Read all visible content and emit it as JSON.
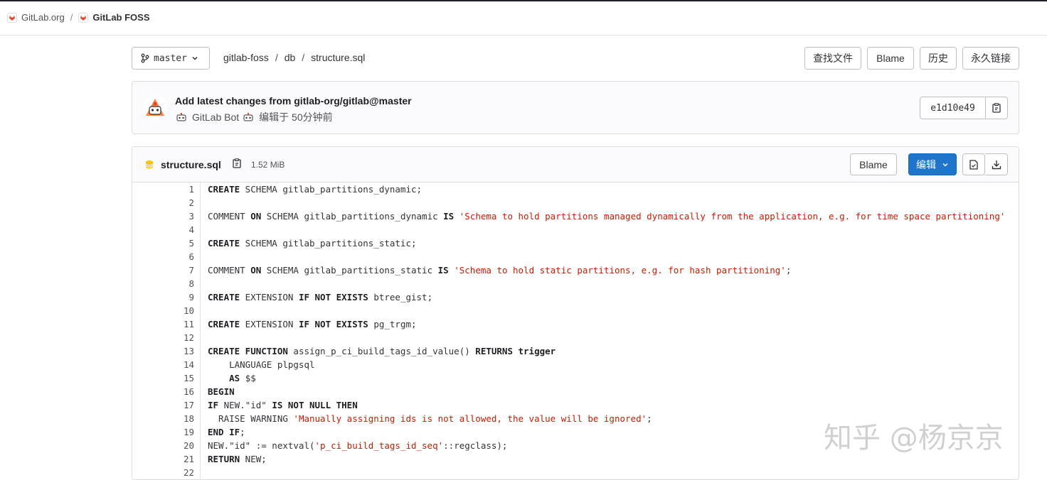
{
  "breadcrumb": {
    "group": "GitLab.org",
    "project": "GitLab FOSS"
  },
  "toolbar": {
    "branch": "master",
    "path": [
      "gitlab-foss",
      "db",
      "structure.sql"
    ],
    "find_file": "查找文件",
    "blame": "Blame",
    "history": "历史",
    "permalink": "永久链接"
  },
  "commit": {
    "title": "Add latest changes from gitlab-org/gitlab@master",
    "author": "GitLab Bot",
    "edited": "编辑于 50分钟前",
    "sha": "e1d10e49"
  },
  "file": {
    "name": "structure.sql",
    "size": "1.52 MiB",
    "blame": "Blame",
    "edit": "编辑"
  },
  "code_lines": [
    {
      "n": "1",
      "parts": [
        [
          "kw",
          "CREATE"
        ],
        [
          "plain",
          " SCHEMA gitlab_partitions_dynamic;"
        ]
      ]
    },
    {
      "n": "2",
      "parts": []
    },
    {
      "n": "3",
      "parts": [
        [
          "plain",
          "COMMENT "
        ],
        [
          "kw",
          "ON"
        ],
        [
          "plain",
          " SCHEMA gitlab_partitions_dynamic "
        ],
        [
          "kw",
          "IS"
        ],
        [
          "plain",
          " "
        ],
        [
          "str",
          "'Schema to hold partitions managed dynamically from the application, e.g. for time space partitioning'"
        ]
      ]
    },
    {
      "n": "4",
      "parts": []
    },
    {
      "n": "5",
      "parts": [
        [
          "kw",
          "CREATE"
        ],
        [
          "plain",
          " SCHEMA gitlab_partitions_static;"
        ]
      ]
    },
    {
      "n": "6",
      "parts": []
    },
    {
      "n": "7",
      "parts": [
        [
          "plain",
          "COMMENT "
        ],
        [
          "kw",
          "ON"
        ],
        [
          "plain",
          " SCHEMA gitlab_partitions_static "
        ],
        [
          "kw",
          "IS"
        ],
        [
          "plain",
          " "
        ],
        [
          "str",
          "'Schema to hold static partitions, e.g. for hash partitioning'"
        ],
        [
          "plain",
          ";"
        ]
      ]
    },
    {
      "n": "8",
      "parts": []
    },
    {
      "n": "9",
      "parts": [
        [
          "kw",
          "CREATE"
        ],
        [
          "plain",
          " EXTENSION "
        ],
        [
          "kw",
          "IF NOT EXISTS"
        ],
        [
          "plain",
          " btree_gist;"
        ]
      ]
    },
    {
      "n": "10",
      "parts": []
    },
    {
      "n": "11",
      "parts": [
        [
          "kw",
          "CREATE"
        ],
        [
          "plain",
          " EXTENSION "
        ],
        [
          "kw",
          "IF NOT EXISTS"
        ],
        [
          "plain",
          " pg_trgm;"
        ]
      ]
    },
    {
      "n": "12",
      "parts": []
    },
    {
      "n": "13",
      "parts": [
        [
          "kw",
          "CREATE FUNCTION"
        ],
        [
          "plain",
          " assign_p_ci_build_tags_id_value() "
        ],
        [
          "kw",
          "RETURNS trigger"
        ]
      ]
    },
    {
      "n": "14",
      "parts": [
        [
          "plain",
          "    LANGUAGE plpgsql"
        ]
      ]
    },
    {
      "n": "15",
      "parts": [
        [
          "plain",
          "    "
        ],
        [
          "kw",
          "AS"
        ],
        [
          "plain",
          " $$"
        ]
      ]
    },
    {
      "n": "16",
      "parts": [
        [
          "kw",
          "BEGIN"
        ]
      ]
    },
    {
      "n": "17",
      "parts": [
        [
          "kw",
          "IF"
        ],
        [
          "plain",
          " NEW.\"id\" "
        ],
        [
          "kw",
          "IS NOT NULL THEN"
        ]
      ]
    },
    {
      "n": "18",
      "parts": [
        [
          "plain",
          "  RAISE WARNING "
        ],
        [
          "str",
          "'Manually assigning ids is not allowed, the value will be ignored'"
        ],
        [
          "plain",
          ";"
        ]
      ]
    },
    {
      "n": "19",
      "parts": [
        [
          "kw",
          "END IF"
        ],
        [
          "plain",
          ";"
        ]
      ]
    },
    {
      "n": "20",
      "parts": [
        [
          "plain",
          "NEW.\"id\" := nextval("
        ],
        [
          "str",
          "'p_ci_build_tags_id_seq'"
        ],
        [
          "plain",
          "::regclass);"
        ]
      ]
    },
    {
      "n": "21",
      "parts": [
        [
          "kw",
          "RETURN"
        ],
        [
          "plain",
          " NEW;"
        ]
      ]
    },
    {
      "n": "22",
      "parts": []
    }
  ],
  "watermark": "知乎 @杨京京"
}
